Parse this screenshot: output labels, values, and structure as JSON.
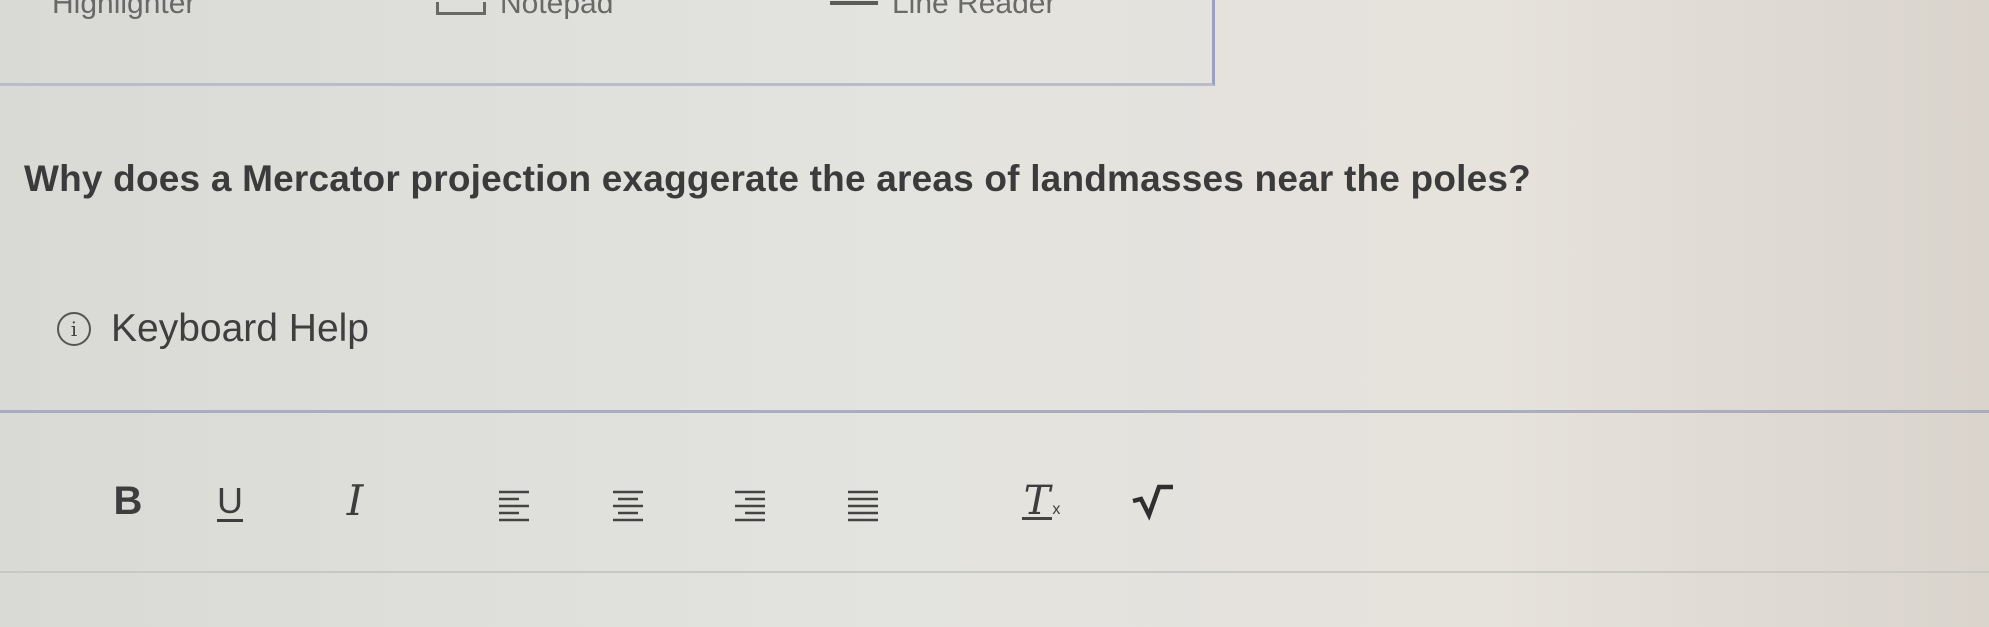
{
  "top_toolbar": {
    "items": [
      {
        "label": "Highlighter",
        "icon": "highlighter-icon"
      },
      {
        "label": "Notepad",
        "icon": "notepad-icon"
      },
      {
        "label": "Line Reader",
        "icon": "line-reader-icon"
      }
    ]
  },
  "question": {
    "text": "Why does a Mercator projection exaggerate the areas of landmasses near the poles?"
  },
  "help": {
    "icon": "info-icon",
    "icon_glyph": "i",
    "label": "Keyboard Help"
  },
  "editor_toolbar": {
    "bold": "B",
    "underline": "U",
    "italic": "I",
    "clear_formatting": "T",
    "clear_formatting_sub": "x",
    "icons": [
      "align-left-icon",
      "align-center-icon",
      "align-right-icon",
      "align-justify-icon",
      "clear-formatting-icon",
      "square-root-icon"
    ]
  },
  "colors": {
    "accent_border": "#9aa0c4",
    "text": "#3b3b3b"
  }
}
